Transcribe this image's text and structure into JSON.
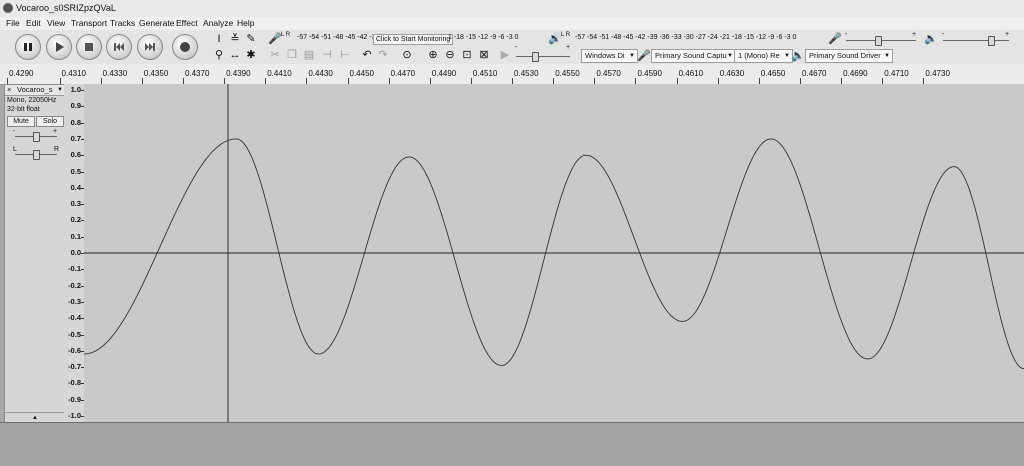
{
  "window": {
    "title": "Vocaroo_s0SRIZpzQVaL"
  },
  "menu": [
    "File",
    "Edit",
    "View",
    "Transport",
    "Tracks",
    "Generate",
    "Effect",
    "Analyze",
    "Help"
  ],
  "transport": {
    "buttons": [
      "pause",
      "play",
      "stop",
      "skip-to-start",
      "skip-to-end",
      "record"
    ]
  },
  "meters": {
    "record_channels": "L R",
    "record_scale": "-57 -54 -51 -48 -45 -42 -3",
    "monitor_label": "Click to Start Monitoring",
    "record_scale_tail": "1 -18 -15 -12 -9 -6 -3 0",
    "play_channels": "L R",
    "play_scale": "-57 -54 -51 -48 -45 -42 -39 -36 -33 -30 -27 -24 -21 -18 -15 -12 -9 -6 -3 0"
  },
  "mixer": {
    "minus": "-",
    "plus": "+"
  },
  "device": {
    "host": "Windows Di",
    "recording_device": "Primary Sound Captu",
    "channels": "1 (Mono) Re",
    "playback_device": "Primary Sound Driver"
  },
  "ruler": {
    "ticks": [
      "0.4290",
      "0.4310",
      "0.4330",
      "0.4350",
      "0.4370",
      "0.4390",
      "0.4410",
      "0.4430",
      "0.4450",
      "0.4470",
      "0.4490",
      "0.4510",
      "0.4530",
      "0.4550",
      "0.4570",
      "0.4590",
      "0.4610",
      "0.4630",
      "0.4650",
      "0.4670",
      "0.4690",
      "0.4710",
      "0.4730"
    ]
  },
  "track": {
    "close": "×",
    "name": "Vocaroo_s",
    "menu_arrow": "▼",
    "format": "Mono, 22050Hz",
    "bit_depth": "32-bit float",
    "mute": "Mute",
    "solo": "Solo",
    "gain_minus": "-",
    "gain_plus": "+",
    "pan_left": "L",
    "pan_right": "R",
    "collapse": "▲"
  },
  "amplitude_scale": [
    "1.0",
    "0.9",
    "0.8",
    "0.7",
    "0.6",
    "0.5",
    "0.4",
    "0.3",
    "0.2",
    "0.1",
    "0.0",
    "-0.1",
    "-0.2",
    "-0.3",
    "-0.4",
    "-0.5",
    "-0.6",
    "-0.7",
    "-0.8",
    "-0.9",
    "-1.0"
  ],
  "waveform": {
    "time_start": 0.4283,
    "time_end": 0.474,
    "cursor_time": 0.4353,
    "extrema": [
      [
        0.4283,
        -0.62
      ],
      [
        0.4357,
        0.7
      ],
      [
        0.4397,
        -0.62
      ],
      [
        0.4441,
        0.59
      ],
      [
        0.4486,
        -0.69
      ],
      [
        0.4527,
        0.6
      ],
      [
        0.4574,
        -0.42
      ],
      [
        0.4617,
        0.7
      ],
      [
        0.4664,
        -0.65
      ],
      [
        0.4706,
        0.53
      ],
      [
        0.474,
        -0.71
      ]
    ]
  }
}
